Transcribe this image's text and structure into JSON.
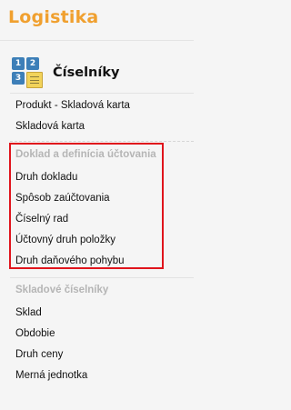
{
  "app": {
    "title": "Logistika"
  },
  "section": {
    "title": "Číselníky",
    "icon": "numbers-table-icon"
  },
  "items_top": [
    {
      "label": "Produkt - Skladová karta"
    },
    {
      "label": "Skladová karta"
    }
  ],
  "group1": {
    "title": "Doklad a definícia účtovania",
    "items": [
      {
        "label": "Druh dokladu"
      },
      {
        "label": "Spôsob zaúčtovania"
      },
      {
        "label": "Číselný rad"
      },
      {
        "label": "Účtovný druh položky"
      },
      {
        "label": "Druh daňového pohybu"
      }
    ]
  },
  "group2": {
    "title": "Skladové číselníky",
    "items": [
      {
        "label": "Sklad"
      },
      {
        "label": "Obdobie"
      },
      {
        "label": "Druh ceny"
      },
      {
        "label": "Merná jednotka"
      }
    ]
  },
  "colors": {
    "title": "#f0a02f",
    "highlight": "#e0141c",
    "group_title": "#b5b5b5"
  }
}
